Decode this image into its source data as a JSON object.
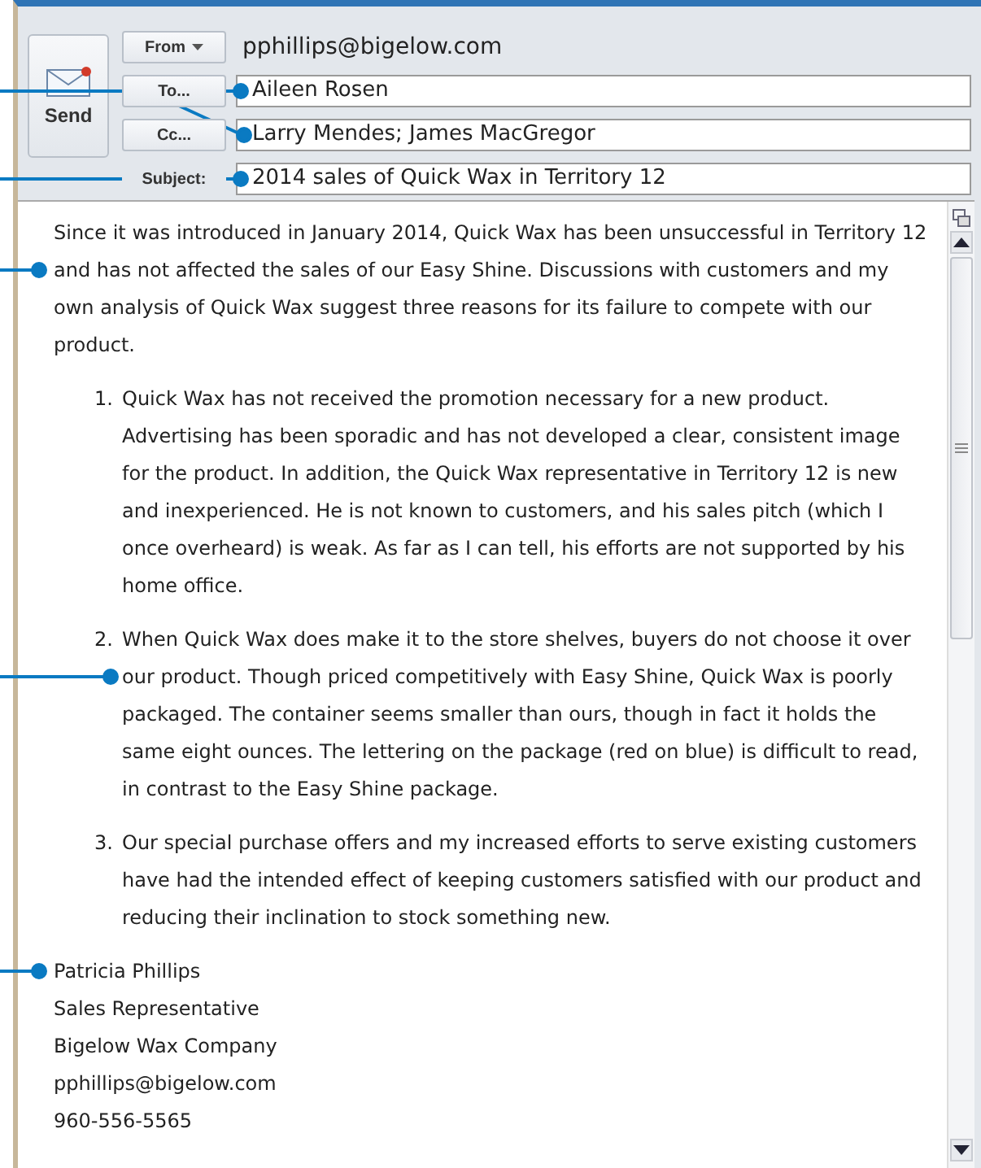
{
  "send_button": {
    "label": "Send"
  },
  "header": {
    "buttons": [
      {
        "label": "From",
        "dropdown": true
      },
      {
        "label": "To..."
      },
      {
        "label": "Cc..."
      }
    ],
    "from": "pphillips@bigelow.com",
    "to": "Aileen Rosen",
    "cc": "Larry Mendes; James MacGregor",
    "subject_label": "Subject:",
    "subject": "2014 sales of Quick Wax in Territory 12"
  },
  "body": {
    "intro": "Since it was introduced in January 2014, Quick Wax has been unsuccessful in Territory 12 and has not affected the sales of our Easy Shine. Discussions with customers and my own analysis of Quick Wax suggest three reasons for its failure to compete with our product.",
    "points": [
      {
        "number": "1.",
        "text": "Quick Wax has not received the promotion necessary for a new product. Advertising has been sporadic and has not developed a clear, consistent image for the product. In addition, the Quick Wax representative in Territory 12 is new and inexperienced. He is not known to customers, and his sales pitch (which I once overheard) is weak. As far as I can tell, his efforts are not supported by his home office."
      },
      {
        "number": "2.",
        "text": "When Quick Wax does make it to the store shelves, buyers do not choose it over our product. Though priced competitively with Easy Shine, Quick Wax is poorly packaged. The container seems smaller than ours, though in fact it holds the same eight ounces. The lettering on the package (red on blue) is difficult to read, in contrast to the Easy Shine package."
      },
      {
        "number": "3.",
        "text": "Our special purchase offers and my increased efforts to serve existing customers have had the intended effect of keeping customers satisfied with our product and reducing their inclination to stock something new."
      }
    ],
    "signature": [
      "Patricia Phillips",
      "Sales Representative",
      "Bigelow Wax Company",
      "pphillips@bigelow.com",
      "960-556-5565"
    ]
  }
}
